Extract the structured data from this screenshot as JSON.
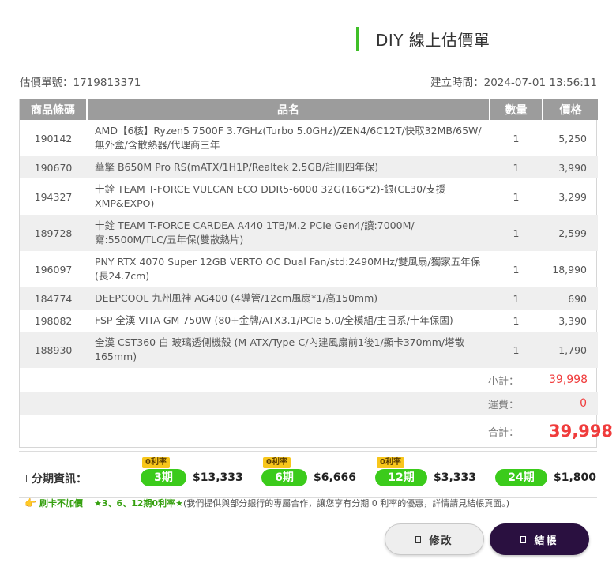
{
  "header": {
    "title": "DIY 線上估價單"
  },
  "meta": {
    "quote_no_label": "估價單號：",
    "quote_no": "1719813371",
    "created_label": "建立時間：",
    "created_at": "2024-07-01 13:56:11"
  },
  "table": {
    "headers": {
      "code": "商品條碼",
      "name": "品名",
      "qty": "數量",
      "price": "價格"
    },
    "items": [
      {
        "code": "190142",
        "name": "AMD【6核】Ryzen5 7500F 3.7GHz(Turbo 5.0GHz)/ZEN4/6C12T/快取32MB/65W/無外盒/含散熱器/代理商三年",
        "qty": "1",
        "price": "5,250"
      },
      {
        "code": "190670",
        "name": "華擎 B650M Pro RS(mATX/1H1P/Realtek 2.5GB/註冊四年保)",
        "qty": "1",
        "price": "3,990"
      },
      {
        "code": "194327",
        "name": "十銓 TEAM T-FORCE VULCAN ECO DDR5-6000 32G(16G*2)-銀(CL30/支援XMP&EXPO)",
        "qty": "1",
        "price": "3,299"
      },
      {
        "code": "189728",
        "name": "十銓 TEAM T-FORCE CARDEA A440 1TB/M.2 PCIe Gen4/讀:7000M/寫:5500M/TLC/五年保(雙散熱片)",
        "qty": "1",
        "price": "2,599"
      },
      {
        "code": "196097",
        "name": "PNY RTX 4070 Super 12GB VERTO OC Dual Fan/std:2490MHz/雙風扇/獨家五年保(長24.7cm)",
        "qty": "1",
        "price": "18,990"
      },
      {
        "code": "184774",
        "name": "DEEPCOOL 九州風神 AG400 (4導管/12cm風扇*1/高150mm)",
        "qty": "1",
        "price": "690"
      },
      {
        "code": "198082",
        "name": "FSP 全漢 VITA GM 750W (80+金牌/ATX3.1/PCIe 5.0/全模組/主日系/十年保固)",
        "qty": "1",
        "price": "3,390"
      },
      {
        "code": "188930",
        "name": "全漢 CST360 白 玻璃透側機殼 (M-ATX/Type-C/內建風扇前1後1/顯卡370mm/塔散165mm)",
        "qty": "1",
        "price": "1,790"
      }
    ],
    "subtotal_label": "小計：",
    "subtotal": "39,998",
    "shipping_label": "運費：",
    "shipping": "0",
    "total_label": "合計：",
    "total": "39,998"
  },
  "installments": {
    "label": "分期資訊：",
    "zero_tag": "0利率",
    "plans": [
      {
        "term": "3期",
        "amount": "$13,333",
        "zero": true
      },
      {
        "term": "6期",
        "amount": "$6,666",
        "zero": true
      },
      {
        "term": "12期",
        "amount": "$3,333",
        "zero": true
      },
      {
        "term": "24期",
        "amount": "$1,800",
        "zero": false
      }
    ]
  },
  "promo": {
    "hand_icon": "👉",
    "highlight1": "刷卡不加價",
    "highlight2": "★3、6、12期0利率★",
    "text": "(我們提供與部分銀行的專屬合作，讓您享有分期 0 利率的優惠，詳情請見結帳頁面。)"
  },
  "actions": {
    "edit_label": "修改",
    "checkout_label": "結帳"
  },
  "colors": {
    "accent_green": "#3bcb1b",
    "price_red": "#f03c3c",
    "checkout_dark": "#2a1040",
    "zero_tag": "#f8c61b"
  }
}
